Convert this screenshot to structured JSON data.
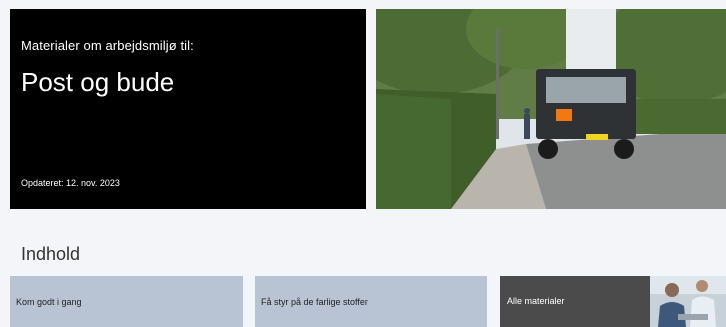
{
  "hero": {
    "eyebrow": "Materialer om arbejdsmiljø til:",
    "title": "Post og bude",
    "updated": "Opdateret: 12. nov. 2023"
  },
  "content": {
    "section_title": "Indhold",
    "cards": [
      {
        "label": "Kom godt i gang"
      },
      {
        "label": "Få styr på de farlige stoffer"
      },
      {
        "label": "Alle materialer"
      }
    ]
  },
  "colors": {
    "hero_bg": "#000000",
    "card_light": "#b8c4d4",
    "card_dark": "#4b4b4b",
    "page_bg": "#f4f5f8"
  }
}
